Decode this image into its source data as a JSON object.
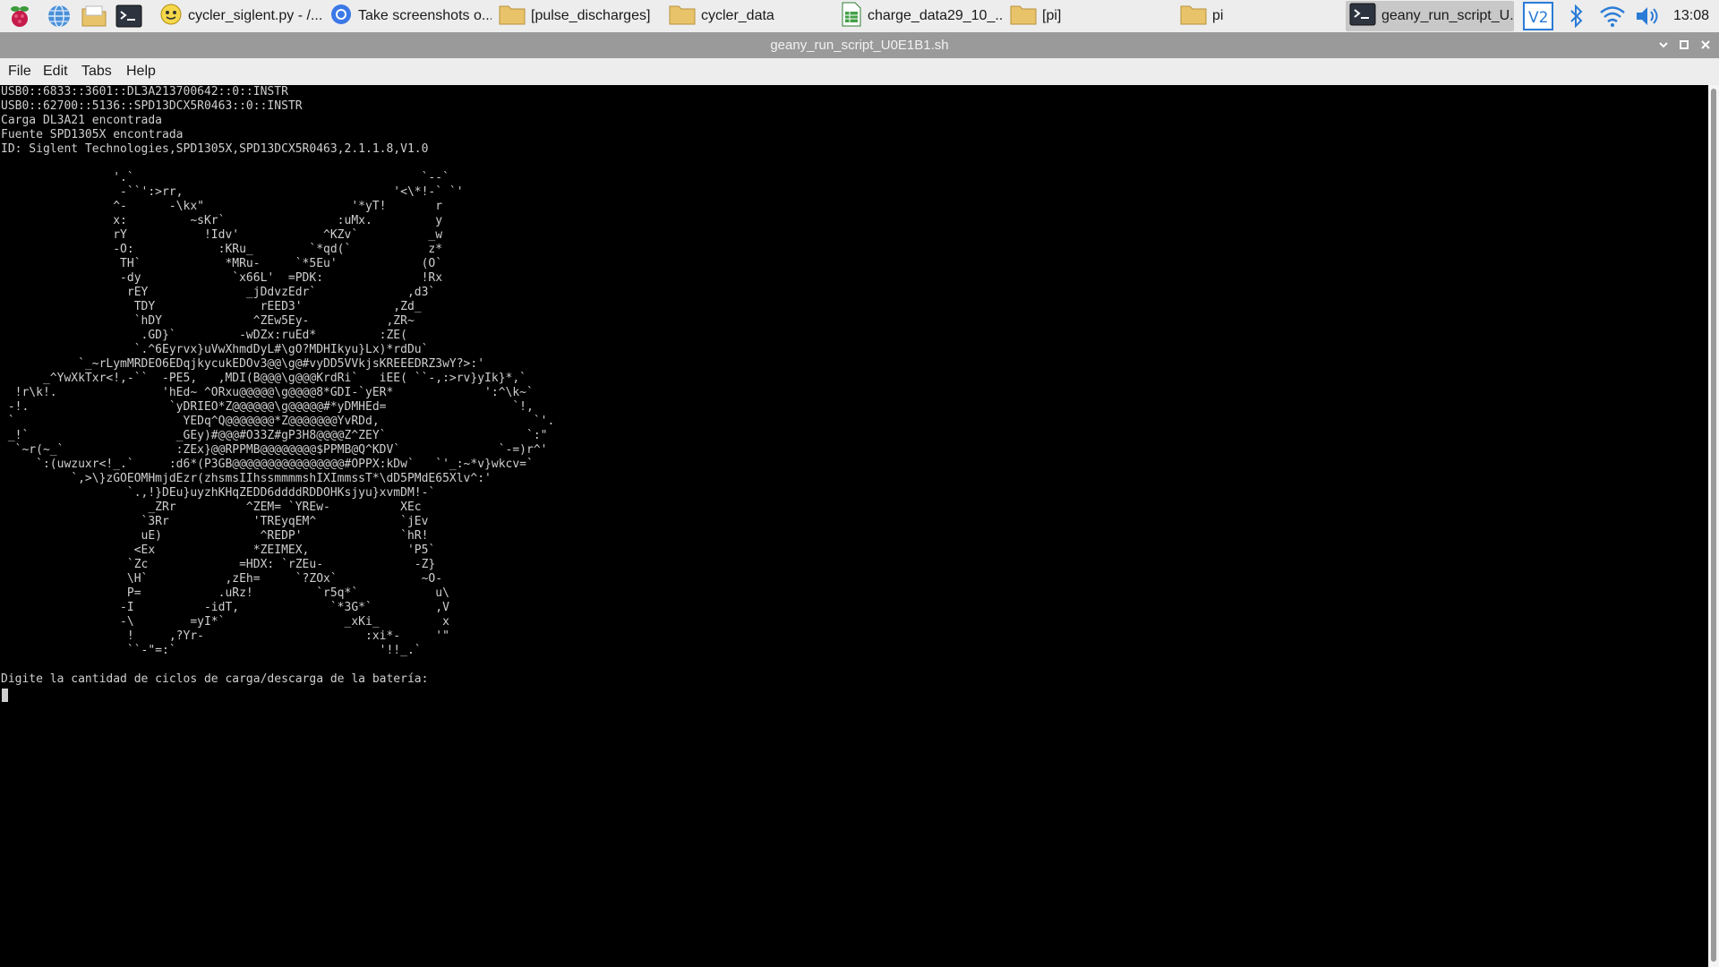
{
  "taskbar": {
    "launchers": [
      {
        "name": "raspberry-menu-icon"
      },
      {
        "name": "web-browser-icon"
      },
      {
        "name": "file-manager-icon"
      },
      {
        "name": "terminal-icon"
      }
    ],
    "tasks": [
      {
        "label": "cycler_siglent.py - /...",
        "icon": "python-file-icon"
      },
      {
        "label": "Take screenshots o...",
        "icon": "chromium-icon"
      },
      {
        "label": "[pulse_discharges]",
        "icon": "folder-icon"
      },
      {
        "label": "cycler_data",
        "icon": "folder-icon"
      },
      {
        "label": "charge_data29_10_...",
        "icon": "spreadsheet-icon"
      },
      {
        "label": "[pi]",
        "icon": "folder-icon"
      },
      {
        "label": "pi",
        "icon": "folder-icon"
      },
      {
        "label": "geany_run_script_U...",
        "icon": "terminal-icon",
        "active": true
      }
    ],
    "tray": [
      "vnc-icon",
      "bluetooth-icon",
      "wifi-icon",
      "volume-icon"
    ],
    "clock": "13:08"
  },
  "window": {
    "title": "geany_run_script_U0E1B1.sh"
  },
  "menu": {
    "file": "File",
    "edit": "Edit",
    "tabs": "Tabs",
    "help": "Help"
  },
  "terminal": {
    "lines": [
      "USB0::6833::3601::DL3A213700642::0::INSTR",
      "USB0::62700::5136::SPD13DCX5R0463::0::INSTR",
      "Carga DL3A21 encontrada",
      "Fuente SPD1305X encontrada",
      "ID: Siglent Technologies,SPD1305X,SPD13DCX5R0463,2.1.1.8,V1.0",
      "",
      "                '.`                                         `--`",
      "                 -``':>rr,                              '<\\*!-` `'",
      "                ^-      -\\kx\"                     '*yT!       r",
      "                x:         ~sKr`                :uMx.         y",
      "                rY           !Idv'            ^KZv`          _w",
      "                -O:            :KRu_        `*qd(`           z*",
      "                 TH`            *MRu-     `*5Eu'            (O`",
      "                 -dy             `x66L'  =PDK:              !Rx",
      "                  rEY              _jDdvzEdr`             ,d3`",
      "                   TDY               rEED3'             ,Zd_",
      "                   `hDY             ^ZEw5Ey-           ,ZR~",
      "                    .GD}`         -wDZx:ruEd*         :ZE(",
      "                   `.^6Eyrvx}uVwXhmdDyL#\\gO?MDHIkyu}Lx)*rdDu`",
      "           `_~rLymMRDEO6EDqjkycukEDOv3@@\\g@#vyDD5VVkjsKREEEDRZ3wY?>:'",
      "      _^YwXkTxr<!,-``  -PE5,   ,MDI(B@@@\\g@@@KrdRi`   iEE( ``-,:>rv}yIk}*,`",
      "  !r\\k!.               'hEd~ ^ORxu@@@@@\\g@@@@8*GDI-`yER*             ':^\\k~`",
      " -!.                    `yDRIEO*Z@@@@@@\\g@@@@@#*yDMHEd=                  `!,",
      " `                        YEDq^Q@@@@@@@*Z@@@@@@@YvRDd,                      `'.",
      " _!`                     _GEy)#@@@#O33Z#gP3H8@@@@Z^ZEY`                    `:\"",
      "  `~r(~_`                :ZEx}@@RPPMB@@@@@@@@$PPMB@Q^KDV`              `-=)r^'",
      "     `:(uwzuxr<!_.`     :d6*(P3GB@@@@@@@@@@@@@@@@#OPPX:kDw`   `'_:~*v}wkcv=`",
      "          `,>\\}zGOEOMHmjdEzr(zhsmsIIhssmmmmshIXImmssT*\\dD5PMdE65Xlv^:'",
      "                  `.,!}DEu}uyzhKHqZEDD6ddddRDDOHKsjyu}xvmDM!-`",
      "                     _ZRr          ^ZEM= `YREw-          XEc",
      "                    `3Rr            'TREyqEM^            `jEv",
      "                    uE)              ^REDP'              `hR!",
      "                   <Ex              *ZEIMEX,              'P5`",
      "                  `Zc             =HDX: `rZEu-             -Z}",
      "                  \\H`           ,zEh=     `?ZOx`            ~O-",
      "                  P=           .uRz!         `r5q*`           u\\",
      "                 -I          -idT,             `*3G*`         ,V",
      "                 -\\        =yI*`                 _xKi_         x",
      "                  !     ,?Yr-                       :xi*-     '\"",
      "                  ``-\"=:`                             '!!_.`",
      "",
      "Digite la cantidad de ciclos de carga/descarga de la batería:"
    ]
  }
}
